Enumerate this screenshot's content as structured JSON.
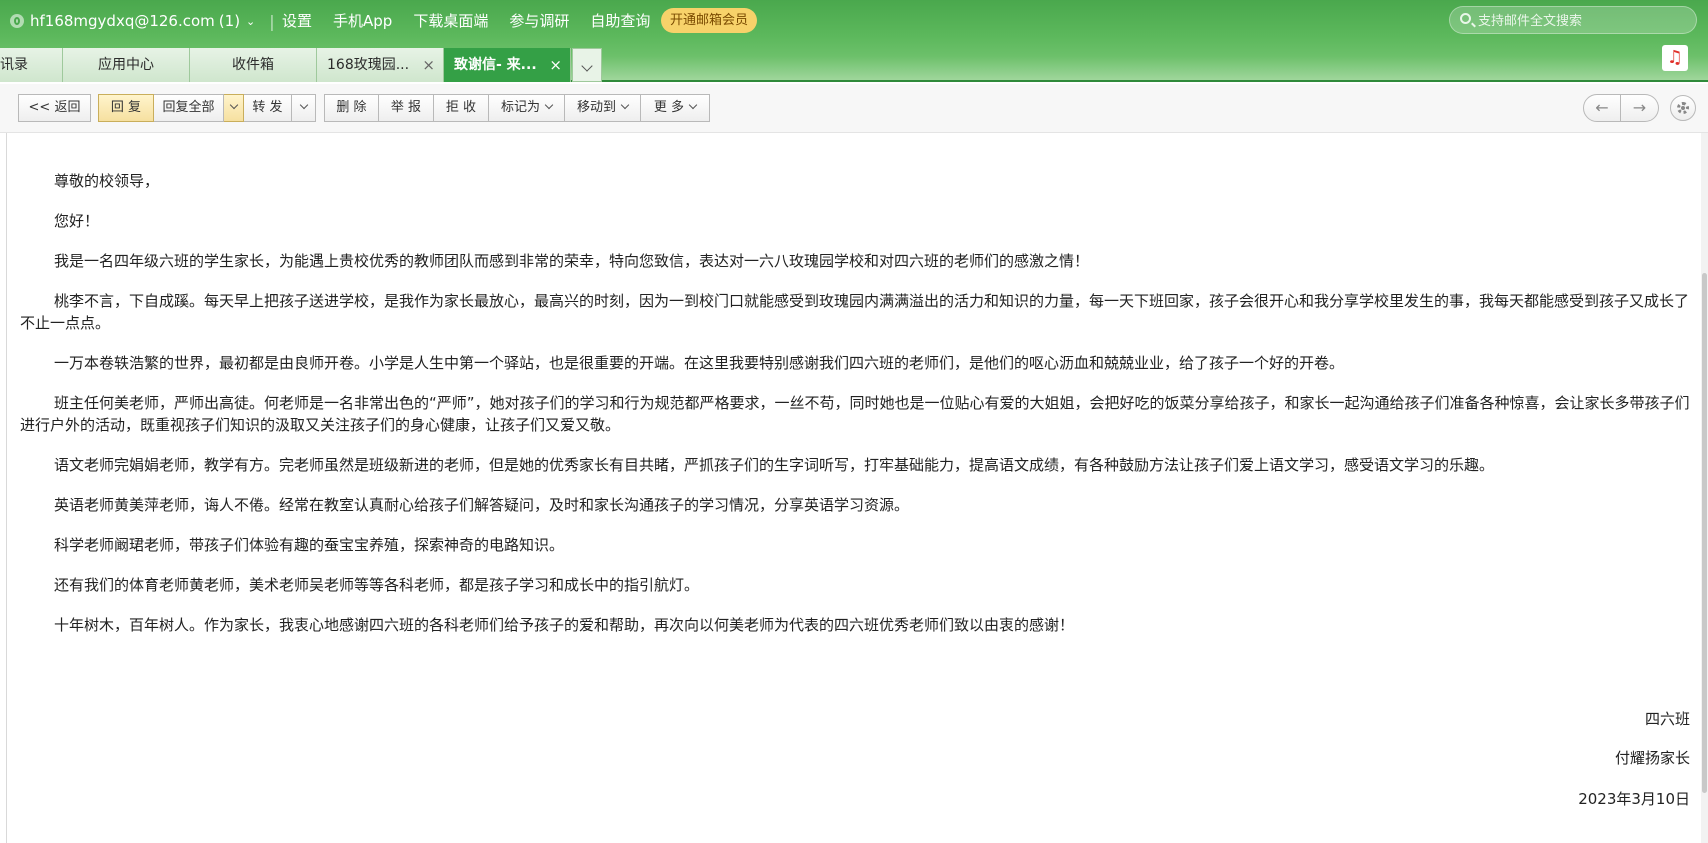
{
  "header": {
    "account": "hf168mgydxq@126.com",
    "unread_count": "(1)",
    "nav": [
      "设置",
      "手机App",
      "下载桌面端",
      "参与调研",
      "自助查询"
    ],
    "vip_label": "开通邮箱会员",
    "search_placeholder": "支持邮件全文搜索"
  },
  "tabs": [
    {
      "label": "讯录"
    },
    {
      "label": "应用中心"
    },
    {
      "label": "收件箱"
    },
    {
      "label": "168玫瑰园...",
      "close": "×"
    },
    {
      "label": "致谢信- 来...",
      "close": "×",
      "active": true
    }
  ],
  "toolbar": {
    "back": "<< 返回",
    "reply": "回 复",
    "reply_all": "回复全部",
    "forward": "转 发",
    "delete": "删 除",
    "report": "举 报",
    "reject": "拒 收",
    "mark_as": "标记为",
    "move_to": "移动到",
    "more": "更 多",
    "prev_icon": "←",
    "next_icon": "→"
  },
  "email": {
    "paragraphs": [
      "尊敬的校领导，",
      "您好！",
      "我是一名四年级六班的学生家长，为能遇上贵校优秀的教师团队而感到非常的荣幸，特向您致信，表达对一六八玫瑰园学校和对四六班的老师们的感激之情！",
      "桃李不言，下自成蹊。每天早上把孩子送进学校，是我作为家长最放心，最高兴的时刻，因为一到校门口就能感受到玫瑰园内满满溢出的活力和知识的力量，每一天下班回家，孩子会很开心和我分享学校里发生的事，我每天都能感受到孩子又成长了不止一点点。",
      "一万本卷轶浩繁的世界，最初都是由良师开卷。小学是人生中第一个驿站，也是很重要的开端。在这里我要特别感谢我们四六班的老师们，是他们的呕心沥血和兢兢业业，给了孩子一个好的开卷。",
      "班主任何美老师，严师出高徒。何老师是一名非常出色的“严师”，她对孩子们的学习和行为规范都严格要求，一丝不苟，同时她也是一位贴心有爱的大姐姐，会把好吃的饭菜分享给孩子，和家长一起沟通给孩子们准备各种惊喜，会让家长多带孩子们进行户外的活动，既重视孩子们知识的汲取又关注孩子们的身心健康，让孩子们又爱又敬。",
      "语文老师完娟娟老师，教学有方。完老师虽然是班级新进的老师，但是她的优秀家长有目共睹，严抓孩子们的生字词听写，打牢基础能力，提高语文成绩，有各种鼓励方法让孩子们爱上语文学习，感受语文学习的乐趣。",
      "英语老师黄美萍老师，诲人不倦。经常在教室认真耐心给孩子们解答疑问，及时和家长沟通孩子的学习情况，分享英语学习资源。",
      "科学老师阚珺老师，带孩子们体验有趣的蚕宝宝养殖，探索神奇的电路知识。",
      "还有我们的体育老师黄老师，美术老师吴老师等等各科老师，都是孩子学习和成长中的指引航灯。",
      "十年树木，百年树人。作为家长，我衷心地感谢四六班的各科老师们给予孩子的爱和帮助，再次向以何美老师为代表的四六班优秀老师们致以由衷的感谢！"
    ],
    "signature": {
      "class": "四六班",
      "name": "付耀扬家长",
      "date": "2023年3月10日"
    }
  }
}
